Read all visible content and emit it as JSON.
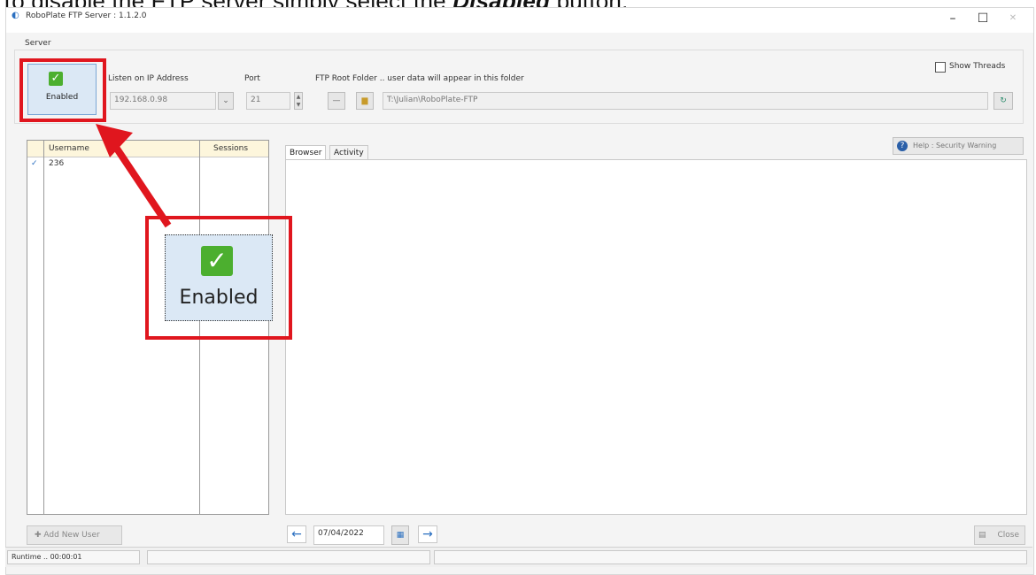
{
  "caption": {
    "prefix": "To disable the FTP server simply select the ",
    "highlight": "Disabled",
    "suffix": " button."
  },
  "window": {
    "title": "RoboPlate FTP Server : 1.1.2.0",
    "minimize": "–",
    "maximize": "☐",
    "close": "✕"
  },
  "server": {
    "group_label": "Server",
    "enabled_label": "Enabled",
    "listen_label": "Listen on IP Address",
    "ip_value": "192.168.0.98",
    "port_label": "Port",
    "port_value": "21",
    "root_label": "FTP Root Folder .. user data will appear in this folder",
    "root_value": "T:\\Julian\\RoboPlate-FTP",
    "show_threads_label": "Show Threads"
  },
  "users": {
    "columns": [
      "Username",
      "Sessions"
    ],
    "rows": [
      {
        "username": "236",
        "checked": "✓"
      }
    ],
    "add_label": "Add New User"
  },
  "tabs": [
    "Browser",
    "Activity"
  ],
  "help_label": "Help : Security Warning",
  "date_value": "07/04/2022",
  "close_label": "Close",
  "status": {
    "runtime": "Runtime .. 00:00:01"
  },
  "zoom": {
    "enabled_label": "Enabled"
  },
  "colors": {
    "annotation": "#e0161e",
    "check_green": "#4caf2f",
    "button_blue": "#dbe8f5"
  }
}
